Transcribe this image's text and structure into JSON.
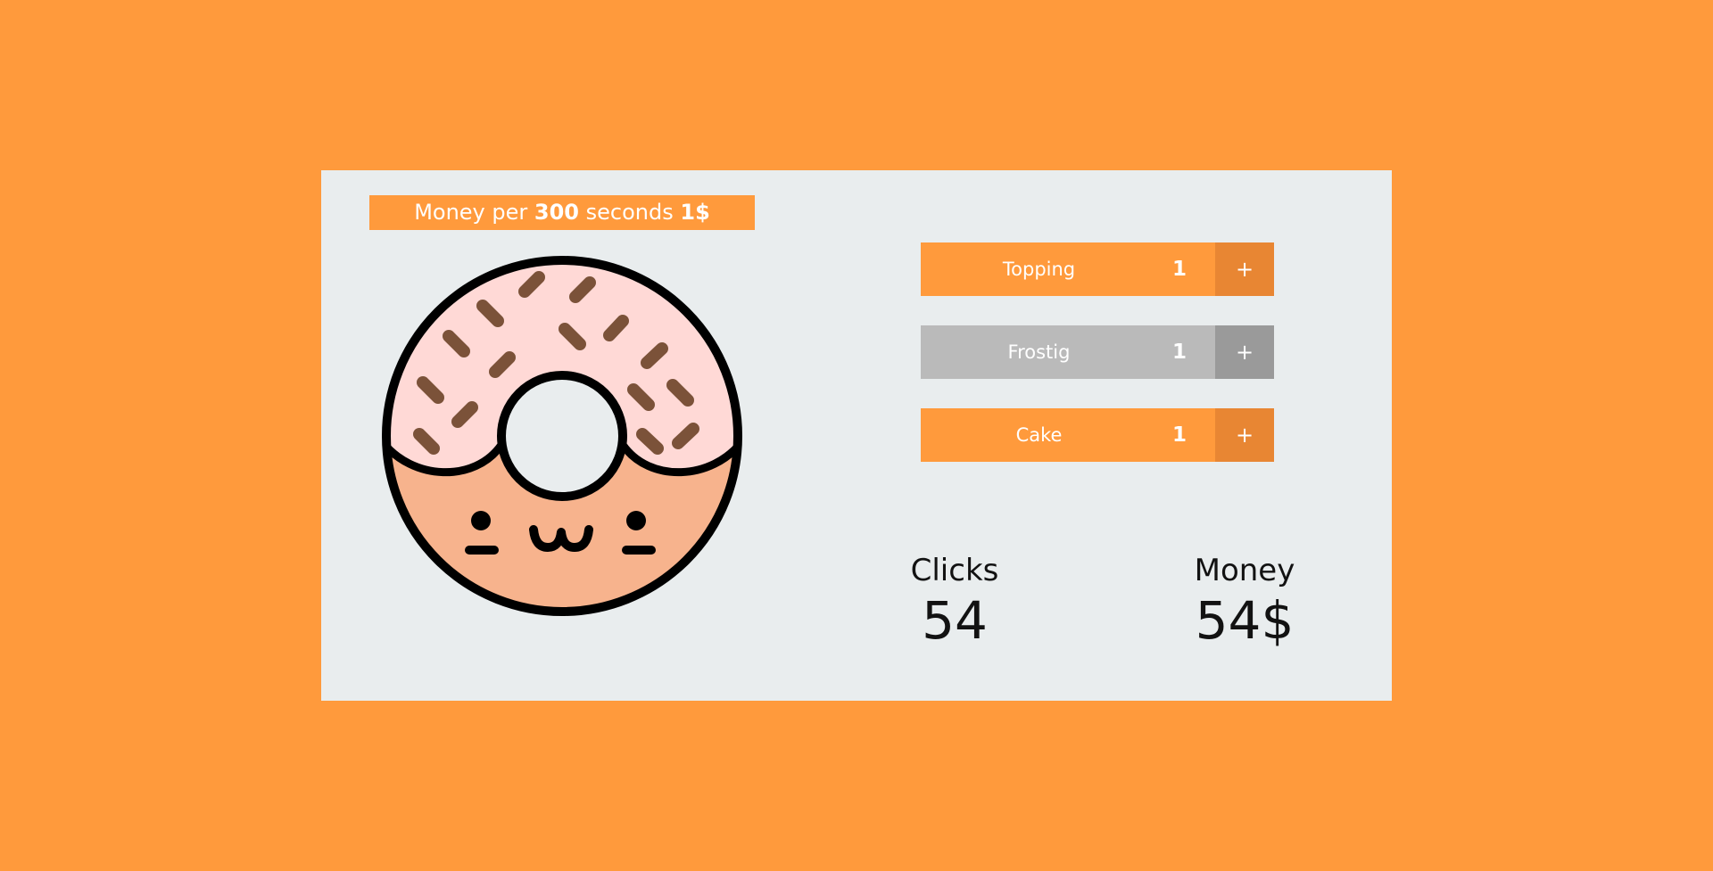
{
  "rate": {
    "prefix": "Money per",
    "seconds": "300",
    "middle": "seconds",
    "amount": "1$"
  },
  "upgrades": [
    {
      "name": "Topping",
      "level": "1",
      "button": "+",
      "state": "active"
    },
    {
      "name": "Frostig",
      "level": "1",
      "button": "+",
      "state": "disabled"
    },
    {
      "name": "Cake",
      "level": "1",
      "button": "+",
      "state": "active"
    }
  ],
  "stats": {
    "clicks_label": "Clicks",
    "clicks_value": "54",
    "money_label": "Money",
    "money_value": "54$"
  },
  "colors": {
    "background": "#FF9A3C",
    "panel": "#E9EDEE",
    "button_plus": "#E88633",
    "disabled": "#BABABA",
    "disabled_plus": "#9A9A9A",
    "icing": "#FFD9D6",
    "dough": "#F7B38D",
    "sprinkle": "#7B5239"
  },
  "icons": {
    "donut": "donut-icon"
  }
}
